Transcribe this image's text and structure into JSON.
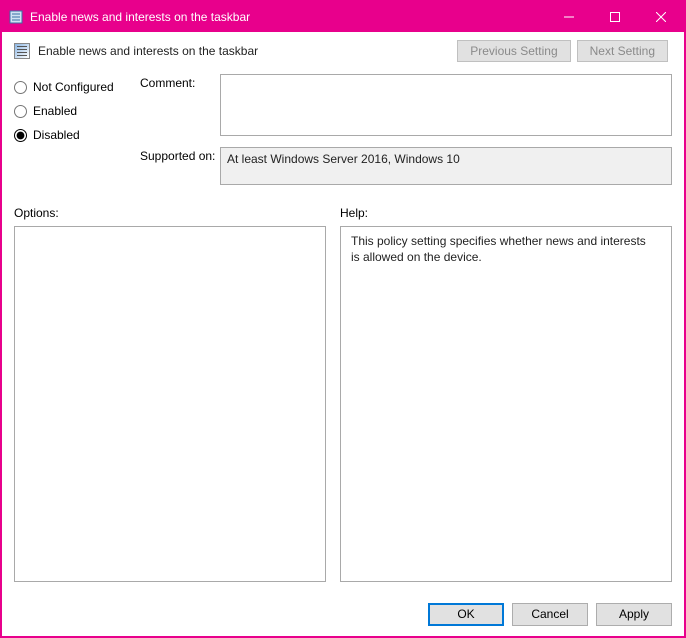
{
  "window": {
    "title": "Enable news and interests on the taskbar",
    "minimize": "−",
    "maximize": "□",
    "close": "×"
  },
  "header": {
    "title": "Enable news and interests on the taskbar",
    "previous": "Previous Setting",
    "next": "Next Setting"
  },
  "radios": {
    "notConfigured": "Not Configured",
    "enabled": "Enabled",
    "disabled": "Disabled",
    "selected": "disabled"
  },
  "fields": {
    "commentLabel": "Comment:",
    "commentValue": "",
    "supportedLabel": "Supported on:",
    "supportedValue": "At least Windows Server 2016, Windows 10"
  },
  "lower": {
    "optionsLabel": "Options:",
    "optionsContent": "",
    "helpLabel": "Help:",
    "helpContent": "This policy setting specifies whether news and interests is allowed on the device."
  },
  "buttons": {
    "ok": "OK",
    "cancel": "Cancel",
    "apply": "Apply"
  }
}
